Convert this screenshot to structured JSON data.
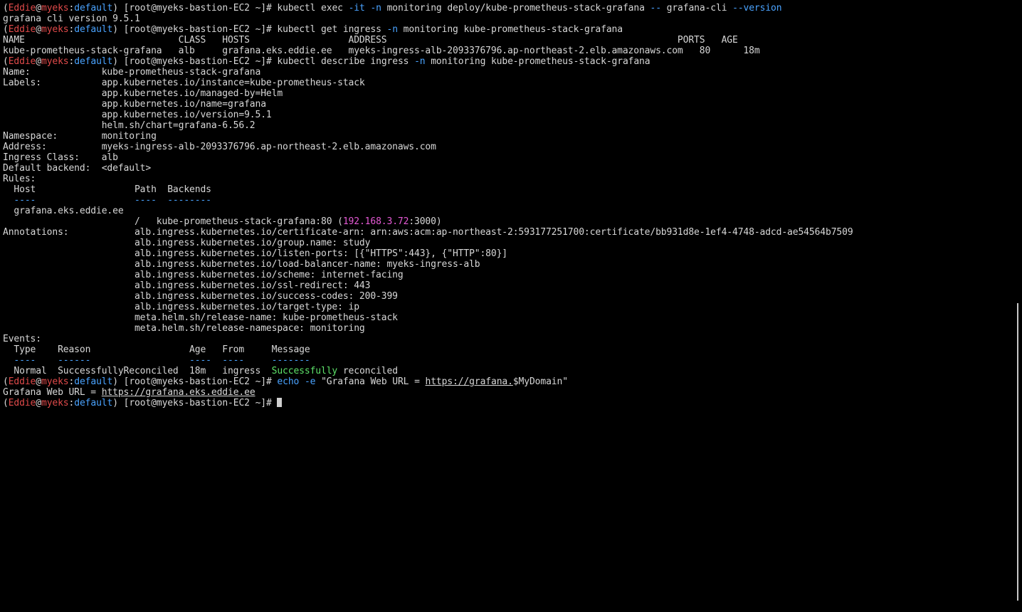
{
  "terminal": {
    "lines": [
      [
        {
          "t": "("
        },
        {
          "t": "Eddie",
          "c": "red"
        },
        {
          "t": "@"
        },
        {
          "t": "myeks",
          "c": "red"
        },
        {
          "t": ":"
        },
        {
          "t": "default",
          "c": "blue"
        },
        {
          "t": ") [root@myeks-bastion-EC2 ~]# kubectl exec "
        },
        {
          "t": "-it",
          "c": "blue"
        },
        {
          "t": " "
        },
        {
          "t": "-n",
          "c": "blue"
        },
        {
          "t": " monitoring deploy/kube-prometheus-stack-grafana "
        },
        {
          "t": "--",
          "c": "blue"
        },
        {
          "t": " grafana-cli "
        },
        {
          "t": "--version",
          "c": "blue"
        }
      ],
      [
        {
          "t": "grafana cli version 9.5.1"
        }
      ],
      [
        {
          "t": "("
        },
        {
          "t": "Eddie",
          "c": "red"
        },
        {
          "t": "@"
        },
        {
          "t": "myeks",
          "c": "red"
        },
        {
          "t": ":"
        },
        {
          "t": "default",
          "c": "blue"
        },
        {
          "t": ") [root@myeks-bastion-EC2 ~]# kubectl get ingress "
        },
        {
          "t": "-n",
          "c": "blue"
        },
        {
          "t": " monitoring kube-prometheus-stack-grafana"
        }
      ],
      [
        {
          "t": "NAME                            CLASS   HOSTS                  ADDRESS                                                     PORTS   AGE"
        }
      ],
      [
        {
          "t": "kube-prometheus-stack-grafana   alb     grafana.eks.eddie.ee   myeks-ingress-alb-2093376796.ap-northeast-2.elb.amazonaws.com   80      18m"
        }
      ],
      [
        {
          "t": "("
        },
        {
          "t": "Eddie",
          "c": "red"
        },
        {
          "t": "@"
        },
        {
          "t": "myeks",
          "c": "red"
        },
        {
          "t": ":"
        },
        {
          "t": "default",
          "c": "blue"
        },
        {
          "t": ") [root@myeks-bastion-EC2 ~]# kubectl describe ingress "
        },
        {
          "t": "-n",
          "c": "blue"
        },
        {
          "t": " monitoring kube-prometheus-stack-grafana"
        }
      ],
      [
        {
          "t": "Name:             kube-prometheus-stack-grafana"
        }
      ],
      [
        {
          "t": "Labels:           app.kubernetes.io/instance=kube-prometheus-stack"
        }
      ],
      [
        {
          "t": "                  app.kubernetes.io/managed-by=Helm"
        }
      ],
      [
        {
          "t": "                  app.kubernetes.io/name=grafana"
        }
      ],
      [
        {
          "t": "                  app.kubernetes.io/version=9.5.1"
        }
      ],
      [
        {
          "t": "                  helm.sh/chart=grafana-6.56.2"
        }
      ],
      [
        {
          "t": "Namespace:        monitoring"
        }
      ],
      [
        {
          "t": "Address:          myeks-ingress-alb-2093376796.ap-northeast-2.elb.amazonaws.com"
        }
      ],
      [
        {
          "t": "Ingress Class:    alb"
        }
      ],
      [
        {
          "t": "Default backend:  <default>"
        }
      ],
      [
        {
          "t": "Rules:"
        }
      ],
      [
        {
          "t": "  Host                  Path  Backends"
        }
      ],
      [
        {
          "t": "  ----                  ----  --------",
          "c": "blue"
        }
      ],
      [
        {
          "t": "  grafana.eks.eddie.ee"
        }
      ],
      [
        {
          "t": "                        /   kube-prometheus-stack-grafana:80 ("
        },
        {
          "t": "192.168.3.72",
          "c": "magenta"
        },
        {
          "t": ":3000)"
        }
      ],
      [
        {
          "t": "Annotations:            alb.ingress.kubernetes.io/certificate-arn: arn:aws:acm:ap-northeast-2:593177251700:certificate/bb931d8e-1ef4-4748-adcd-ae54564b7509"
        }
      ],
      [
        {
          "t": "                        alb.ingress.kubernetes.io/group.name: study"
        }
      ],
      [
        {
          "t": "                        alb.ingress.kubernetes.io/listen-ports: [{\"HTTPS\":443}, {\"HTTP\":80}]"
        }
      ],
      [
        {
          "t": "                        alb.ingress.kubernetes.io/load-balancer-name: myeks-ingress-alb"
        }
      ],
      [
        {
          "t": "                        alb.ingress.kubernetes.io/scheme: internet-facing"
        }
      ],
      [
        {
          "t": "                        alb.ingress.kubernetes.io/ssl-redirect: 443"
        }
      ],
      [
        {
          "t": "                        alb.ingress.kubernetes.io/success-codes: 200-399"
        }
      ],
      [
        {
          "t": "                        alb.ingress.kubernetes.io/target-type: ip"
        }
      ],
      [
        {
          "t": "                        meta.helm.sh/release-name: kube-prometheus-stack"
        }
      ],
      [
        {
          "t": "                        meta.helm.sh/release-namespace: monitoring"
        }
      ],
      [
        {
          "t": "Events:"
        }
      ],
      [
        {
          "t": "  Type    Reason                  Age   From     Message"
        }
      ],
      [
        {
          "t": "  ----    ------                  ----  ----     -------",
          "c": "blue"
        }
      ],
      [
        {
          "t": "  Normal  SuccessfullyReconciled  18m   ingress  "
        },
        {
          "t": "Successfully",
          "c": "green"
        },
        {
          "t": " reconciled"
        }
      ],
      [
        {
          "t": "("
        },
        {
          "t": "Eddie",
          "c": "red"
        },
        {
          "t": "@"
        },
        {
          "t": "myeks",
          "c": "red"
        },
        {
          "t": ":"
        },
        {
          "t": "default",
          "c": "blue"
        },
        {
          "t": ") [root@myeks-bastion-EC2 ~]# "
        },
        {
          "t": "echo",
          "c": "blue"
        },
        {
          "t": " "
        },
        {
          "t": "-e",
          "c": "blue"
        },
        {
          "t": " \"Grafana Web URL = "
        },
        {
          "t": "https://grafana.",
          "u": true
        },
        {
          "t": "$MyDomain\""
        }
      ],
      [
        {
          "t": "Grafana Web URL = "
        },
        {
          "t": "https://grafana.eks.eddie.ee",
          "u": true
        }
      ],
      [
        {
          "t": "("
        },
        {
          "t": "Eddie",
          "c": "red"
        },
        {
          "t": "@"
        },
        {
          "t": "myeks",
          "c": "red"
        },
        {
          "t": ":"
        },
        {
          "t": "default",
          "c": "blue"
        },
        {
          "t": ") [root@myeks-bastion-EC2 ~]# "
        },
        {
          "cursor": true
        }
      ]
    ]
  },
  "colors": {
    "background": "#000000",
    "text": "#d7d7d7",
    "red": "#e04a4a",
    "blue": "#4aa3ff",
    "magenta": "#e65ad6",
    "green": "#5ee36a"
  }
}
